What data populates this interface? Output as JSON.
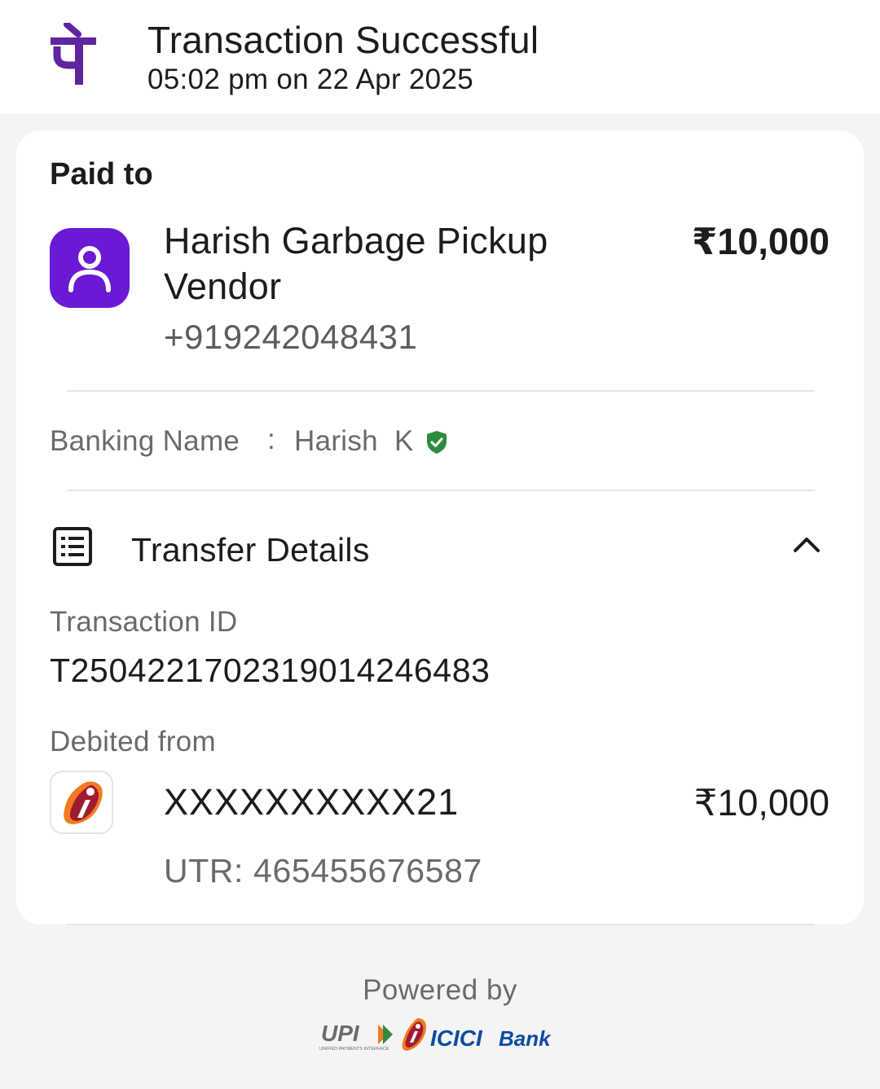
{
  "header": {
    "logo_icon": "phonepe-logo-icon",
    "title": "Transaction Successful",
    "timestamp": "05:02 pm on 22 Apr 2025"
  },
  "paid_to": {
    "label": "Paid to",
    "avatar_icon": "person-icon",
    "name": "Harish Garbage Pickup Vendor",
    "amount": "₹10,000",
    "phone": "+919242048431"
  },
  "banking_name": {
    "label": "Banking Name",
    "separator": ":",
    "value": "Harish  K",
    "verified_icon": "verified-shield-icon"
  },
  "transfer_details": {
    "icon": "receipt-list-icon",
    "title": "Transfer Details",
    "toggle_icon": "chevron-up-icon",
    "transaction_id_label": "Transaction ID",
    "transaction_id": "T2504221702319014246483",
    "debited_from_label": "Debited from",
    "bank_icon": "icici-bank-icon",
    "account": "XXXXXXXXXX21",
    "amount": "₹10,000",
    "utr": "UTR: 465455676587"
  },
  "footer": {
    "powered_by": "Powered by",
    "upi_brand": "UPI",
    "upi_tagline": "UNIFIED PAYMENTS INTERFACE",
    "bank_brand_primary": "ICICI",
    "bank_brand_secondary": "Bank"
  },
  "colors": {
    "brand_purple": "#5f259f",
    "avatar_purple": "#6a19d4",
    "verified_green": "#2e8b3e",
    "icici_orange": "#f47920",
    "icici_maroon": "#9e1b32",
    "icici_blue": "#0a4da2"
  }
}
